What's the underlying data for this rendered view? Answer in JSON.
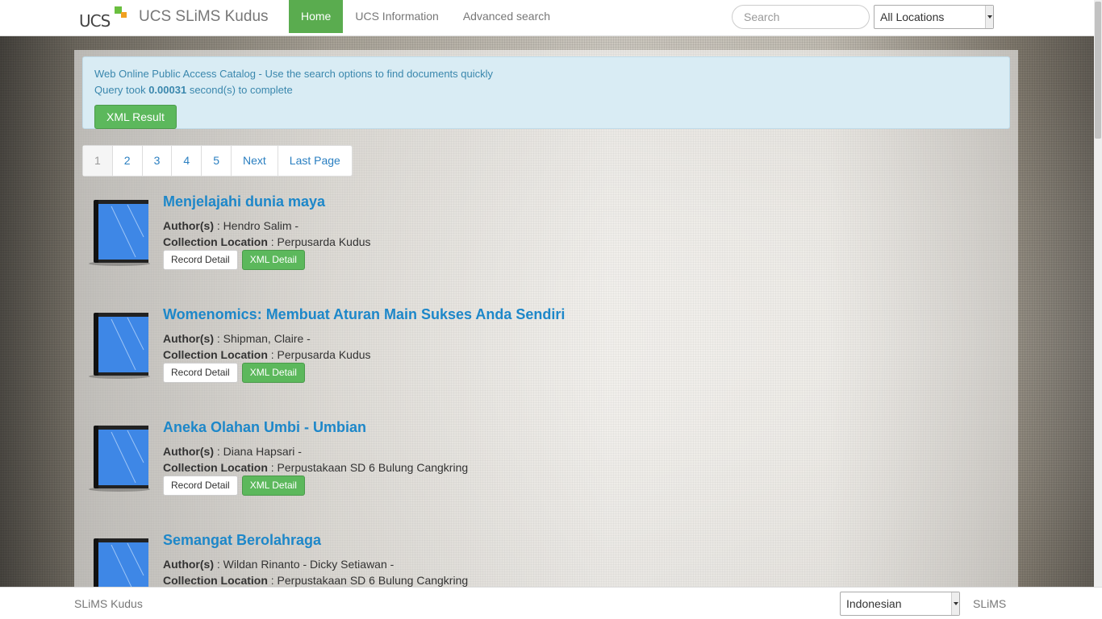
{
  "header": {
    "logo_text": "UCS",
    "brand": "UCS SLiMS Kudus",
    "nav": [
      {
        "label": "Home"
      },
      {
        "label": "UCS Information"
      },
      {
        "label": "Advanced search"
      }
    ],
    "search_placeholder": "Search",
    "location_select": "All Locations"
  },
  "info": {
    "line1": "Web Online Public Access Catalog - Use the search options to find documents quickly",
    "query_prefix": "Query took ",
    "query_time": "0.00031",
    "query_suffix": " second(s) to complete",
    "xml_button": "XML Result"
  },
  "pagination": [
    "1",
    "2",
    "3",
    "4",
    "5",
    "Next",
    "Last Page"
  ],
  "labels": {
    "author": "Author(s)",
    "location": "Collection Location",
    "record_detail": "Record Detail",
    "xml_detail": "XML Detail"
  },
  "results": [
    {
      "title": "Menjelajahi dunia maya",
      "authors": " : Hendro Salim -",
      "location": " : Perpusarda Kudus"
    },
    {
      "title": "Womenomics: Membuat Aturan Main Sukses Anda Sendiri",
      "authors": " : Shipman, Claire -",
      "location": " : Perpusarda Kudus"
    },
    {
      "title": "Aneka Olahan Umbi - Umbian",
      "authors": " : Diana Hapsari -",
      "location": " : Perpustakaan SD 6 Bulung Cangkring"
    },
    {
      "title": "Semangat Berolahraga",
      "authors": " : Wildan Rinanto - Dicky Setiawan -",
      "location": " : Perpustakaan SD 6 Bulung Cangkring"
    }
  ],
  "footer": {
    "left": "SLiMS Kudus",
    "language": "Indonesian",
    "right": "SLiMS"
  },
  "colors": {
    "accent_green": "#5cb85c",
    "link_blue": "#1d87c9",
    "info_bg": "#d9ecf4"
  }
}
